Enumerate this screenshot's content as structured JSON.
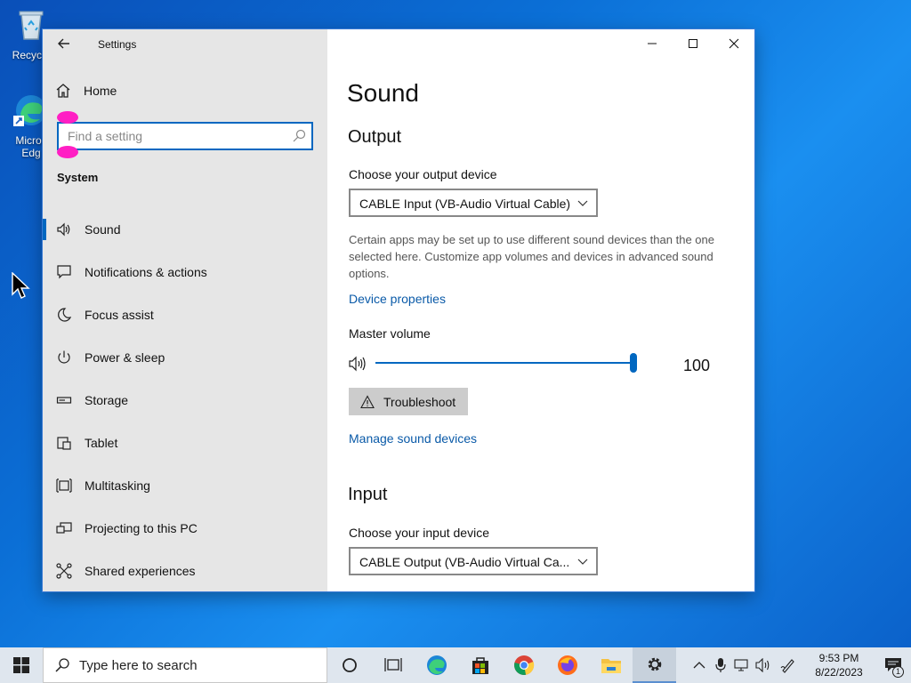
{
  "desktop": {
    "icons": [
      {
        "label": "Recycle"
      },
      {
        "label": "Micros\nEdg"
      }
    ]
  },
  "window": {
    "title": "Settings",
    "sidebar": {
      "home": "Home",
      "search_placeholder": "Find a setting",
      "group": "System",
      "items": [
        {
          "label": "Sound",
          "icon": "speaker-icon",
          "active": true
        },
        {
          "label": "Notifications & actions",
          "icon": "notification-icon"
        },
        {
          "label": "Focus assist",
          "icon": "moon-icon"
        },
        {
          "label": "Power & sleep",
          "icon": "power-icon"
        },
        {
          "label": "Storage",
          "icon": "storage-icon"
        },
        {
          "label": "Tablet",
          "icon": "tablet-icon"
        },
        {
          "label": "Multitasking",
          "icon": "multitasking-icon"
        },
        {
          "label": "Projecting to this PC",
          "icon": "projecting-icon"
        },
        {
          "label": "Shared experiences",
          "icon": "shared-icon"
        }
      ]
    },
    "content": {
      "page_title": "Sound",
      "output": {
        "heading": "Output",
        "choose_label": "Choose your output device",
        "device": "CABLE Input (VB-Audio Virtual Cable)",
        "description": "Certain apps may be set up to use different sound devices than the one selected here. Customize app volumes and devices in advanced sound options.",
        "device_properties_link": "Device properties",
        "master_volume_label": "Master volume",
        "volume_value": "100",
        "volume_level": 100,
        "troubleshoot_label": "Troubleshoot",
        "manage_link": "Manage sound devices"
      },
      "input": {
        "heading": "Input",
        "choose_label": "Choose your input device",
        "device": "CABLE Output (VB-Audio Virtual Ca..."
      }
    }
  },
  "taskbar": {
    "search_placeholder": "Type here to search",
    "time": "9:53 PM",
    "date": "8/22/2023",
    "notification_count": "1"
  },
  "colors": {
    "accent": "#0067c0",
    "link": "#0a5aa8",
    "marker": "#ff1fc4"
  }
}
